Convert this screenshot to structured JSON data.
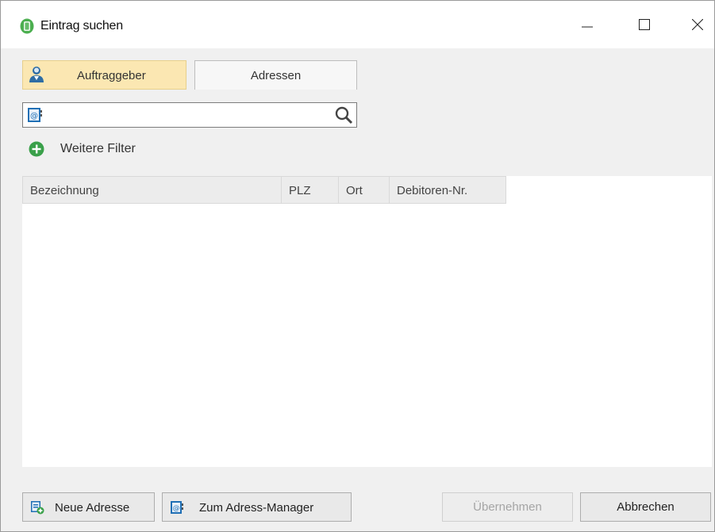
{
  "window": {
    "title": "Eintrag suchen",
    "controls": {
      "minimize": "minimize-icon",
      "maximize": "maximize-icon",
      "close": "close-icon"
    }
  },
  "tabs": [
    {
      "label": "Auftraggeber",
      "active": true,
      "icon": "person-icon"
    },
    {
      "label": "Adressen",
      "active": false
    }
  ],
  "search": {
    "value": "",
    "placeholder": "",
    "prefix_icon": "address-book-icon",
    "button_icon": "search-icon"
  },
  "filter": {
    "label": "Weitere Filter",
    "icon": "plus-circle-icon"
  },
  "table": {
    "columns": [
      "Bezeichnung",
      "PLZ",
      "Ort",
      "Debitoren-Nr."
    ],
    "rows": []
  },
  "buttons": {
    "new_address": "Neue Adresse",
    "address_manager": "Zum Adress-Manager",
    "apply": "Übernehmen",
    "cancel": "Abbrechen"
  },
  "colors": {
    "active_tab": "#fbe7b2",
    "filter_icon": "#3aa04a",
    "app_icon": "#4caf50"
  }
}
